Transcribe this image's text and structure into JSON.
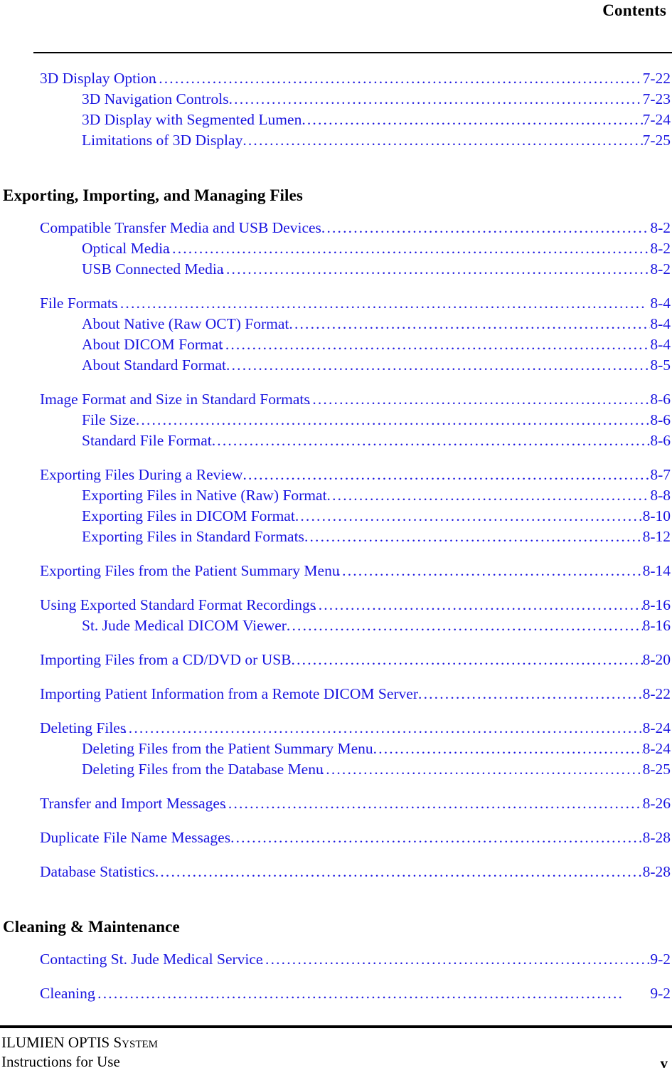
{
  "header": {
    "title": "Contents"
  },
  "footer": {
    "line1_part1": "I",
    "line1_part2": "LUMIEN",
    "line1_part3": "O",
    "line1_part4": "PTIS",
    "line1_part5": "System",
    "line1_full": "ILUMIEN OPTIS System",
    "line2": "Instructions for Use",
    "page_number": "v"
  },
  "chapters": [
    {
      "title": "",
      "groups": [
        {
          "entries": [
            {
              "level": 1,
              "text": "3D Display Option",
              "page": "7-22",
              "tight": true
            },
            {
              "level": 2,
              "text": "3D Navigation Controls",
              "page": "7-23",
              "tight": false
            },
            {
              "level": 2,
              "text": "3D Display with Segmented Lumen",
              "page": "7-24",
              "tight": false
            },
            {
              "level": 2,
              "text": "Limitations of 3D Display",
              "page": "7-25",
              "tight": false
            }
          ]
        }
      ]
    },
    {
      "title": "Exporting, Importing, and Managing Files",
      "groups": [
        {
          "entries": [
            {
              "level": 1,
              "text": "Compatible Transfer Media and USB Devices",
              "page": "8-2",
              "tight": false
            },
            {
              "level": 2,
              "text": "Optical Media",
              "page": "8-2",
              "tight": true
            },
            {
              "level": 2,
              "text": "USB Connected Media",
              "page": "8-2",
              "tight": true
            }
          ]
        },
        {
          "entries": [
            {
              "level": 1,
              "text": "File Formats",
              "page": "8-4",
              "tight": true
            },
            {
              "level": 2,
              "text": "About Native (Raw OCT) Format",
              "page": "8-4",
              "tight": false
            },
            {
              "level": 2,
              "text": "About DICOM Format",
              "page": "8-4",
              "tight": true
            },
            {
              "level": 2,
              "text": "About Standard Format",
              "page": "8-5",
              "tight": false
            }
          ]
        },
        {
          "entries": [
            {
              "level": 1,
              "text": "Image Format and Size in Standard Formats",
              "page": "8-6",
              "tight": true
            },
            {
              "level": 2,
              "text": "File Size",
              "page": "8-6",
              "tight": false
            },
            {
              "level": 2,
              "text": "Standard File Format",
              "page": "8-6",
              "tight": false
            }
          ]
        },
        {
          "entries": [
            {
              "level": 1,
              "text": "Exporting Files During a Review",
              "page": "8-7",
              "tight": false
            },
            {
              "level": 2,
              "text": "Exporting Files in Native (Raw) Format",
              "page": "8-8",
              "tight": false
            },
            {
              "level": 2,
              "text": "Exporting Files in DICOM Format",
              "page": "8-10",
              "tight": false
            },
            {
              "level": 2,
              "text": "Exporting Files in Standard Formats",
              "page": "8-12",
              "tight": false
            }
          ]
        },
        {
          "entries": [
            {
              "level": 1,
              "text": "Exporting Files from the Patient Summary Menu",
              "page": "8-14",
              "tight": true
            }
          ]
        },
        {
          "entries": [
            {
              "level": 1,
              "text": "Using Exported Standard Format Recordings",
              "page": "8-16",
              "tight": true
            },
            {
              "level": 2,
              "text": "St. Jude Medical DICOM Viewer",
              "page": "8-16",
              "tight": false
            }
          ]
        },
        {
          "entries": [
            {
              "level": 1,
              "text": "Importing Files from a CD/DVD or USB",
              "page": "8-20",
              "tight": false
            }
          ]
        },
        {
          "entries": [
            {
              "level": 1,
              "text": "Importing Patient Information from a Remote DICOM Server",
              "page": "8-22",
              "tight": false
            }
          ]
        },
        {
          "entries": [
            {
              "level": 1,
              "text": "Deleting Files",
              "page": "8-24",
              "tight": true
            },
            {
              "level": 2,
              "text": "Deleting Files from the Patient Summary Menu",
              "page": "8-24",
              "tight": false
            },
            {
              "level": 2,
              "text": "Deleting Files from the Database Menu",
              "page": "8-25",
              "tight": true
            }
          ]
        },
        {
          "entries": [
            {
              "level": 1,
              "text": "Transfer and Import Messages",
              "page": "8-26",
              "tight": true
            }
          ]
        },
        {
          "entries": [
            {
              "level": 1,
              "text": "Duplicate File Name Messages",
              "page": "8-28",
              "tight": false
            }
          ]
        },
        {
          "entries": [
            {
              "level": 1,
              "text": "Database Statistics",
              "page": "8-28",
              "tight": false
            }
          ]
        }
      ]
    },
    {
      "title": "Cleaning & Maintenance",
      "groups": [
        {
          "entries": [
            {
              "level": 1,
              "text": "Contacting St. Jude Medical Service",
              "page": "9-2",
              "tight": true
            }
          ]
        },
        {
          "entries": [
            {
              "level": 1,
              "text": "Cleaning",
              "page": "9-2",
              "tight": true
            }
          ]
        }
      ]
    }
  ],
  "colors": {
    "link_blue": "#1a15e0",
    "text_black": "#000000",
    "background": "#ffffff"
  }
}
